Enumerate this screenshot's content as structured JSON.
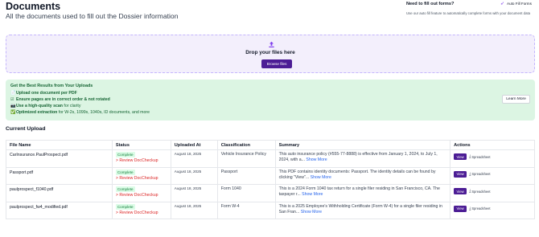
{
  "header": {
    "title": "Documents",
    "subtitle": "All the documents used to fill out the Dossier information"
  },
  "autofill": {
    "title": "Need to fill out forms?",
    "button_label": "Auto Fill Forms",
    "description": "Use our auto fill feature to automatically complete forms with your document data"
  },
  "dropzone": {
    "text": "Drop your files here",
    "browse_label": "Browse files"
  },
  "tips": {
    "title": "Get the Best Results from Your Uploads",
    "items": [
      {
        "icon": "📄",
        "bold": "Upload one document per PDF",
        "rest": ""
      },
      {
        "icon": "☑",
        "bold": "Ensure pages are in correct order & not rotated",
        "rest": ""
      },
      {
        "icon": "📷",
        "bold": "Use a high-quality scan",
        "rest": " for clarity"
      },
      {
        "icon": "✅",
        "bold": "Optimized extraction",
        "rest": " for W-2s, 1099s, 1040s, ID documents, and more"
      }
    ],
    "learn_more_label": "Learn More"
  },
  "current_upload": {
    "title": "Current Upload",
    "columns": [
      "File Name",
      "Status",
      "Uploaded At",
      "Classification",
      "Summary",
      "Actions"
    ],
    "rows": [
      {
        "file": "CarInsurance.PaulProspect.pdf",
        "status": "Complete",
        "review": "> Review DocCheckup",
        "uploaded": "August 18, 2025",
        "classification": "Vehicle Insurance Policy",
        "summary": "This auto insurance policy (#555-77-8888) is effective from January 1, 2024, to July 1, 2024, with a...",
        "show_more": "Show More",
        "view": "View",
        "spreadsheet": "Spreadsheet"
      },
      {
        "file": "Passport.pdf",
        "status": "Complete",
        "review": "> Review DocCheckup",
        "uploaded": "August 18, 2025",
        "classification": "Passport",
        "summary": "This PDF contains identity documents: Passport. The identity details can be found by clicking \"View\"...",
        "show_more": "Show More",
        "view": "View",
        "spreadsheet": "Spreadsheet"
      },
      {
        "file": "paulprospect_f1040.pdf",
        "status": "Complete",
        "review": "> Review DocCheckup",
        "uploaded": "August 18, 2025",
        "classification": "Form 1040",
        "summary": "This is a 2024 Form 1040 tax return for a single filer residing in San Francisco, CA. The taxpayer r...",
        "show_more": "Show More",
        "view": "View",
        "spreadsheet": "Spreadsheet"
      },
      {
        "file": "paulprospect_fw4_modified.pdf",
        "status": "Complete",
        "review": "> Review DocCheckup",
        "uploaded": "August 18, 2025",
        "classification": "Form W-4",
        "summary": "This is a 2025 Employee's Withholding Certificate (Form W-4) for a single filer residing in San Fran...",
        "show_more": "Show More",
        "view": "View",
        "spreadsheet": "Spreadsheet"
      }
    ]
  },
  "colors": {
    "accent": "#4c1d95",
    "tips_bg": "#dcf5e3",
    "dropzone_bg": "#f3effc",
    "status_green": "#15803d",
    "review_red": "#dc2626",
    "link_blue": "#2563eb"
  }
}
